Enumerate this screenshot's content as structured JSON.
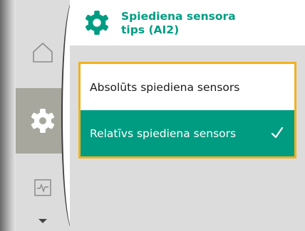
{
  "header": {
    "title_line1": "Spiediena sensora",
    "title_line2": "tips (AI2)",
    "icon": "gear-icon"
  },
  "sidebar": {
    "items": [
      {
        "name": "home",
        "icon": "home-icon",
        "selected": false
      },
      {
        "name": "settings",
        "icon": "gear-icon",
        "selected": true
      },
      {
        "name": "diagnostics",
        "icon": "pulse-icon",
        "selected": false
      }
    ],
    "more_icon": "chevron-down-icon"
  },
  "options": [
    {
      "label": "Absolūts spiediena sensors",
      "selected": false
    },
    {
      "label": "Relatīvs spiediena sensors",
      "selected": true
    }
  ],
  "colors": {
    "accent": "#009c82",
    "focus": "#f2b11f",
    "nav_bg": "#dcdcdc",
    "nav_selected": "#a7a79e"
  }
}
